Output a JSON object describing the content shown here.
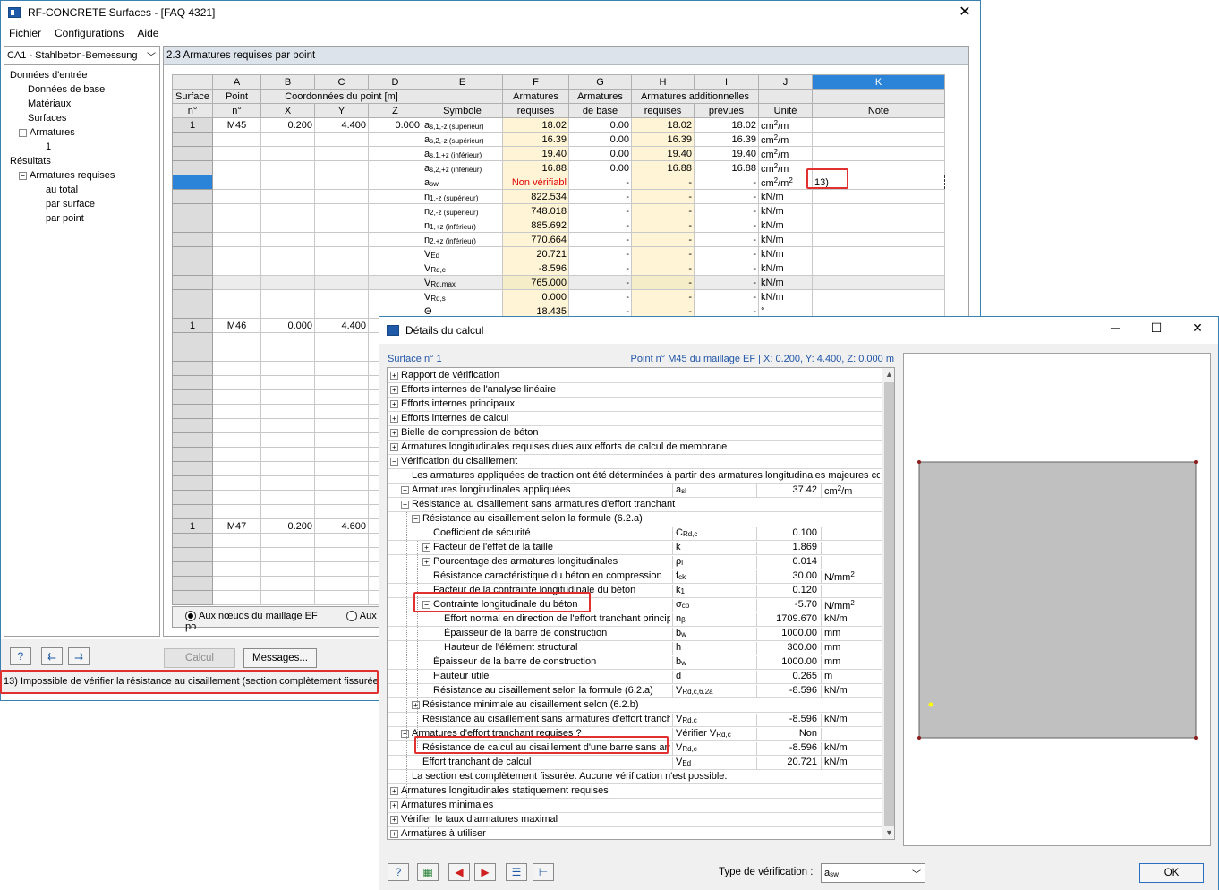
{
  "main": {
    "title": "RF-CONCRETE Surfaces - [FAQ 4321]",
    "menu": [
      "Fichier",
      "Configurations",
      "Aide"
    ],
    "case_combo": "CA1 - Stahlbeton-Bemessung",
    "tree": [
      {
        "label": "Données d'entrée",
        "level": 0,
        "toggle": ""
      },
      {
        "label": "Données de base",
        "level": 1,
        "toggle": ""
      },
      {
        "label": "Matériaux",
        "level": 1,
        "toggle": ""
      },
      {
        "label": "Surfaces",
        "level": 1,
        "toggle": ""
      },
      {
        "label": "Armatures",
        "level": 1,
        "toggle": "−"
      },
      {
        "label": "1",
        "level": 2,
        "toggle": ""
      },
      {
        "label": "Résultats",
        "level": 0,
        "toggle": ""
      },
      {
        "label": "Armatures requises",
        "level": 1,
        "toggle": "−"
      },
      {
        "label": "au total",
        "level": 2,
        "toggle": ""
      },
      {
        "label": "par surface",
        "level": 2,
        "toggle": ""
      },
      {
        "label": "par point",
        "level": 2,
        "toggle": ""
      }
    ],
    "panel_title": "2.3 Armatures requises par point",
    "columns": {
      "letters": [
        "A",
        "B",
        "C",
        "D",
        "E",
        "F",
        "G",
        "H",
        "I",
        "J",
        "K"
      ],
      "rowhead_1": "Surface",
      "rowhead_2": "n°",
      "point_1": "Point",
      "point_2": "n°",
      "coords": "Coordonnées du point [m]",
      "x": "X",
      "y": "Y",
      "z": "Z",
      "symbole": "Symbole",
      "f1": "Armatures",
      "f2": "requises",
      "g1": "Armatures",
      "g2": "de base",
      "hi": "Armatures additionnelles",
      "h2": "requises",
      "i2": "prévues",
      "unite": "Unité",
      "note": "Note"
    },
    "points": [
      {
        "surface": "1",
        "point": "M45",
        "x": "0.200",
        "y": "4.400",
        "z": "0.000"
      },
      {
        "surface": "1",
        "point": "M46",
        "x": "0.000",
        "y": "4.400"
      },
      {
        "surface": "1",
        "point": "M47",
        "x": "0.200",
        "y": "4.600"
      }
    ],
    "rows": [
      {
        "sym": "a",
        "sub": "s,1,-z (supérieur)",
        "f": "18.02",
        "g": "0.00",
        "h": "18.02",
        "i": "18.02",
        "unit": "cm",
        "usup": "2",
        "utail": "/m"
      },
      {
        "sym": "a",
        "sub": "s,2,-z (supérieur)",
        "f": "16.39",
        "g": "0.00",
        "h": "16.39",
        "i": "16.39",
        "unit": "cm",
        "usup": "2",
        "utail": "/m"
      },
      {
        "sym": "a",
        "sub": "s,1,+z (inférieur)",
        "f": "19.40",
        "g": "0.00",
        "h": "19.40",
        "i": "19.40",
        "unit": "cm",
        "usup": "2",
        "utail": "/m"
      },
      {
        "sym": "a",
        "sub": "s,2,+z (inférieur)",
        "f": "16.88",
        "g": "0.00",
        "h": "16.88",
        "i": "16.88",
        "unit": "cm",
        "usup": "2",
        "utail": "/m"
      },
      {
        "sym": "a",
        "sub": "sw",
        "f": "Non vérifiabl",
        "g": "-",
        "h": "-",
        "i": "-",
        "unit": "cm",
        "usup": "2",
        "utail": "/m",
        "usup2": "2",
        "note": "13)"
      },
      {
        "sym": "n",
        "sub": "1,-z (supérieur)",
        "f": "822.534",
        "g": "-",
        "h": "-",
        "i": "-",
        "unit": "kN/m"
      },
      {
        "sym": "n",
        "sub": "2,-z (supérieur)",
        "f": "748.018",
        "g": "-",
        "h": "-",
        "i": "-",
        "unit": "kN/m"
      },
      {
        "sym": "n",
        "sub": "1,+z (inférieur)",
        "f": "885.692",
        "g": "-",
        "h": "-",
        "i": "-",
        "unit": "kN/m"
      },
      {
        "sym": "n",
        "sub": "2,+z (inférieur)",
        "f": "770.664",
        "g": "-",
        "h": "-",
        "i": "-",
        "unit": "kN/m"
      },
      {
        "sym": "V",
        "sub": "Ed",
        "f": "20.721",
        "g": "-",
        "h": "-",
        "i": "-",
        "unit": "kN/m"
      },
      {
        "sym": "V",
        "sub": "Rd,c",
        "f": "-8.596",
        "g": "-",
        "h": "-",
        "i": "-",
        "unit": "kN/m"
      },
      {
        "sym": "V",
        "sub": "Rd,max",
        "f": "765.000",
        "g": "-",
        "h": "-",
        "i": "-",
        "unit": "kN/m"
      },
      {
        "sym": "V",
        "sub": "Rd,s",
        "f": "0.000",
        "g": "-",
        "h": "-",
        "i": "-",
        "unit": "kN/m"
      },
      {
        "sym": "Θ",
        "sub": "",
        "f": "18.435",
        "g": "-",
        "h": "-",
        "i": "-",
        "unit": "°"
      }
    ],
    "radio1": "Aux nœuds du maillage EF",
    "radio2": "Aux po",
    "calcul": "Calcul",
    "messages": "Messages...",
    "status": "13) Impossible de vérifier la résistance au cisaillement (section complètement fissurée)"
  },
  "dialog": {
    "title": "Détails du calcul",
    "surface": "Surface n° 1",
    "point_info": "Point n° M45 du maillage EF |  X: 0.200, Y: 4.400, Z: 0.000 m",
    "rows": [
      {
        "label": "Rapport de vérification",
        "level": 0,
        "toggle": "+"
      },
      {
        "label": "Efforts internes de l'analyse linéaire",
        "level": 0,
        "toggle": "+"
      },
      {
        "label": "Efforts internes principaux",
        "level": 0,
        "toggle": "+"
      },
      {
        "label": "Efforts internes de calcul",
        "level": 0,
        "toggle": "+"
      },
      {
        "label": "Bielle de compression de béton",
        "level": 0,
        "toggle": "+"
      },
      {
        "label": "Armatures longitudinales requises dues aux efforts de calcul de membrane",
        "level": 0,
        "toggle": "+"
      },
      {
        "label": "Vérification du cisaillement",
        "level": 0,
        "toggle": "−"
      },
      {
        "label": "Les armatures appliquées de traction ont été déterminées à partir des armatures longitudinales majeures corresp",
        "level": 1,
        "toggle": ""
      },
      {
        "label": "Armatures longitudinales appliquées",
        "level": 1,
        "toggle": "+",
        "sym": "a",
        "ssub": "sl",
        "val": "37.42",
        "unit": "cm",
        "usup": "2",
        "utail": "/m"
      },
      {
        "label": "Résistance au cisaillement sans armatures d'effort tranchant",
        "level": 1,
        "toggle": "−"
      },
      {
        "label": "Résistance au cisaillement selon la formule (6.2.a)",
        "level": 2,
        "toggle": "−"
      },
      {
        "label": "Coefficient de sécurité",
        "level": 3,
        "toggle": "",
        "sym": "C",
        "ssub": "Rd,c",
        "val": "0.100",
        "unit": ""
      },
      {
        "label": "Facteur de l'effet de la taille",
        "level": 3,
        "toggle": "+",
        "sym": "k",
        "ssub": "",
        "val": "1.869",
        "unit": ""
      },
      {
        "label": "Pourcentage des armatures longitudinales",
        "level": 3,
        "toggle": "+",
        "sym": "ρ",
        "ssub": "l",
        "val": "0.014",
        "unit": ""
      },
      {
        "label": "Résistance caractéristique du béton en compression",
        "level": 3,
        "toggle": "",
        "sym": "f",
        "ssub": "ck",
        "val": "30.00",
        "unit": "N/mm",
        "usup": "2"
      },
      {
        "label": "Facteur de la contrainte longitudinale du béton",
        "level": 3,
        "toggle": "",
        "sym": "k",
        "ssub": "1",
        "val": "0.120",
        "unit": ""
      },
      {
        "label": "Contrainte longitudinale du béton",
        "level": 3,
        "toggle": "−",
        "sym": "σ",
        "ssub": "cp",
        "val": "-5.70",
        "unit": "N/mm",
        "usup": "2"
      },
      {
        "label": "Effort normal en direction de l'effort tranchant principa",
        "level": 4,
        "toggle": "",
        "sym": "n",
        "ssub": "β",
        "val": "1709.670",
        "unit": "kN/m"
      },
      {
        "label": "Épaisseur de la barre de construction",
        "level": 4,
        "toggle": "",
        "sym": "b",
        "ssub": "w",
        "val": "1000.00",
        "unit": "mm"
      },
      {
        "label": "Hauteur de l'élément structural",
        "level": 4,
        "toggle": "",
        "sym": "h",
        "ssub": "",
        "val": "300.00",
        "unit": "mm"
      },
      {
        "label": "Épaisseur de la barre de construction",
        "level": 3,
        "toggle": "",
        "sym": "b",
        "ssub": "w",
        "val": "1000.00",
        "unit": "mm"
      },
      {
        "label": "Hauteur utile",
        "level": 3,
        "toggle": "",
        "sym": "d",
        "ssub": "",
        "val": "0.265",
        "unit": "m"
      },
      {
        "label": "Résistance au cisaillement selon la formule (6.2.a)",
        "level": 3,
        "toggle": "",
        "sym": "V",
        "ssub": "Rd,c,6.2a",
        "val": "-8.596",
        "unit": "kN/m"
      },
      {
        "label": "Résistance minimale au cisaillement selon (6.2.b)",
        "level": 2,
        "toggle": "+"
      },
      {
        "label": "Résistance au cisaillement sans armatures d'effort trancha",
        "level": 2,
        "toggle": "",
        "sym": "V",
        "ssub": "Rd,c",
        "val": "-8.596",
        "unit": "kN/m"
      },
      {
        "label": "Armatures d'effort tranchant requises ?",
        "level": 1,
        "toggle": "−",
        "sym": "Vérifier V",
        "ssub": "Rd,c",
        "val": "Non",
        "unit": ""
      },
      {
        "label": "Résistance de calcul au cisaillement d'une barre sans arm",
        "level": 2,
        "toggle": "",
        "sym": "V",
        "ssub": "Rd,c",
        "val": "-8.596",
        "unit": "kN/m"
      },
      {
        "label": "Effort tranchant de calcul",
        "level": 2,
        "toggle": "",
        "sym": "V",
        "ssub": "Ed",
        "val": "20.721",
        "unit": "kN/m"
      },
      {
        "label": "La section est complètement fissurée. Aucune vérification n'est possible.",
        "level": 1,
        "toggle": ""
      },
      {
        "label": "Armatures longitudinales statiquement requises",
        "level": 0,
        "toggle": "+"
      },
      {
        "label": "Armatures minimales",
        "level": 0,
        "toggle": "+"
      },
      {
        "label": "Vérifier le taux d'armatures maximal",
        "level": 0,
        "toggle": "+"
      },
      {
        "label": "Armatures à utiliser",
        "level": 0,
        "toggle": "+"
      }
    ],
    "type_label": "Type de vérification :",
    "type_value": "a",
    "type_sub": "sw",
    "ok": "OK"
  },
  "preview": {
    "fill": "#c0c0c0",
    "corner_color": "#8b1a1a",
    "point_color": "#ffff00",
    "point_v_fraction": 0.885
  }
}
